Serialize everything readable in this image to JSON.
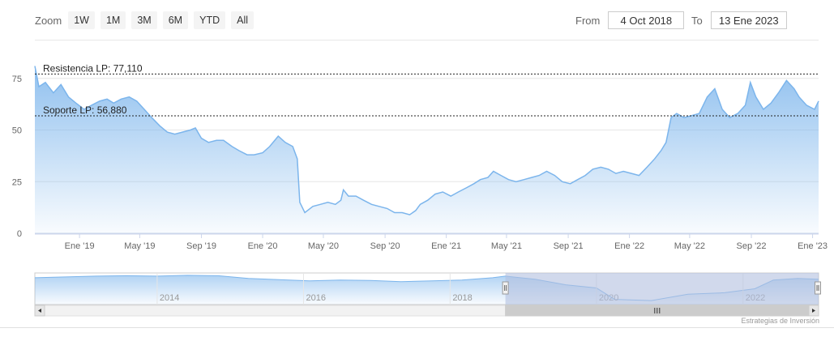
{
  "range_selector": {
    "zoom_label": "Zoom",
    "buttons": [
      "1W",
      "1M",
      "3M",
      "6M",
      "YTD",
      "All"
    ],
    "from_label": "From",
    "from_value": "4 Oct 2018",
    "to_label": "To",
    "to_value": "13 Ene 2023"
  },
  "credit": "Estrategias de Inversión",
  "colors": {
    "line": "#7cb5ec",
    "fill_top": "#7cb5ec",
    "reference_line": "#222222",
    "navigator_mask": "#b3bfe0"
  },
  "chart_data": {
    "type": "area",
    "title": "",
    "xlabel": "",
    "ylabel": "",
    "ylim": [
      0,
      80
    ],
    "yticks": [
      0,
      25,
      50,
      75
    ],
    "x_range": [
      "2018-10-04",
      "2023-01-13"
    ],
    "x_tick_labels": [
      {
        "date": "2019-01-01",
        "label": "Ene '19"
      },
      {
        "date": "2019-05-01",
        "label": "May '19"
      },
      {
        "date": "2019-09-01",
        "label": "Sep '19"
      },
      {
        "date": "2020-01-01",
        "label": "Ene '20"
      },
      {
        "date": "2020-05-01",
        "label": "May '20"
      },
      {
        "date": "2020-09-01",
        "label": "Sep '20"
      },
      {
        "date": "2021-01-01",
        "label": "Ene '21"
      },
      {
        "date": "2021-05-01",
        "label": "May '21"
      },
      {
        "date": "2021-09-01",
        "label": "Sep '21"
      },
      {
        "date": "2022-01-01",
        "label": "Ene '22"
      },
      {
        "date": "2022-05-01",
        "label": "May '22"
      },
      {
        "date": "2022-09-01",
        "label": "Sep '22"
      },
      {
        "date": "2023-01-01",
        "label": "Ene '23"
      }
    ],
    "series": [
      {
        "points": [
          [
            "2018-10-04",
            81
          ],
          [
            "2018-10-12",
            71
          ],
          [
            "2018-10-25",
            73
          ],
          [
            "2018-11-10",
            68
          ],
          [
            "2018-11-25",
            72
          ],
          [
            "2018-12-10",
            66
          ],
          [
            "2018-12-25",
            63
          ],
          [
            "2019-01-10",
            60
          ],
          [
            "2019-01-25",
            62
          ],
          [
            "2019-02-10",
            64
          ],
          [
            "2019-02-25",
            65
          ],
          [
            "2019-03-10",
            63
          ],
          [
            "2019-03-25",
            65
          ],
          [
            "2019-04-10",
            66
          ],
          [
            "2019-04-25",
            64
          ],
          [
            "2019-05-10",
            60
          ],
          [
            "2019-05-25",
            56
          ],
          [
            "2019-06-10",
            52
          ],
          [
            "2019-06-25",
            49
          ],
          [
            "2019-07-10",
            48
          ],
          [
            "2019-07-25",
            49
          ],
          [
            "2019-08-10",
            50
          ],
          [
            "2019-08-20",
            51
          ],
          [
            "2019-09-01",
            46
          ],
          [
            "2019-09-15",
            44
          ],
          [
            "2019-10-01",
            45
          ],
          [
            "2019-10-15",
            45
          ],
          [
            "2019-11-01",
            42
          ],
          [
            "2019-11-15",
            40
          ],
          [
            "2019-12-01",
            38
          ],
          [
            "2019-12-15",
            38
          ],
          [
            "2020-01-01",
            39
          ],
          [
            "2020-01-15",
            42
          ],
          [
            "2020-02-01",
            47
          ],
          [
            "2020-02-15",
            44
          ],
          [
            "2020-03-01",
            42
          ],
          [
            "2020-03-10",
            36
          ],
          [
            "2020-03-15",
            15
          ],
          [
            "2020-03-25",
            10
          ],
          [
            "2020-04-10",
            13
          ],
          [
            "2020-04-25",
            14
          ],
          [
            "2020-05-10",
            15
          ],
          [
            "2020-05-25",
            14
          ],
          [
            "2020-06-05",
            16
          ],
          [
            "2020-06-10",
            21
          ],
          [
            "2020-06-20",
            18
          ],
          [
            "2020-07-05",
            18
          ],
          [
            "2020-07-20",
            16
          ],
          [
            "2020-08-05",
            14
          ],
          [
            "2020-08-20",
            13
          ],
          [
            "2020-09-05",
            12
          ],
          [
            "2020-09-20",
            10
          ],
          [
            "2020-10-05",
            10
          ],
          [
            "2020-10-20",
            9
          ],
          [
            "2020-11-01",
            11
          ],
          [
            "2020-11-10",
            14
          ],
          [
            "2020-11-25",
            16
          ],
          [
            "2020-12-10",
            19
          ],
          [
            "2020-12-25",
            20
          ],
          [
            "2021-01-10",
            18
          ],
          [
            "2021-01-25",
            20
          ],
          [
            "2021-02-10",
            22
          ],
          [
            "2021-02-25",
            24
          ],
          [
            "2021-03-10",
            26
          ],
          [
            "2021-03-25",
            27
          ],
          [
            "2021-04-05",
            30
          ],
          [
            "2021-04-20",
            28
          ],
          [
            "2021-05-05",
            26
          ],
          [
            "2021-05-20",
            25
          ],
          [
            "2021-06-05",
            26
          ],
          [
            "2021-06-20",
            27
          ],
          [
            "2021-07-05",
            28
          ],
          [
            "2021-07-20",
            30
          ],
          [
            "2021-08-05",
            28
          ],
          [
            "2021-08-20",
            25
          ],
          [
            "2021-09-05",
            24
          ],
          [
            "2021-09-20",
            26
          ],
          [
            "2021-10-05",
            28
          ],
          [
            "2021-10-20",
            31
          ],
          [
            "2021-11-05",
            32
          ],
          [
            "2021-11-20",
            31
          ],
          [
            "2021-12-05",
            29
          ],
          [
            "2021-12-20",
            30
          ],
          [
            "2022-01-05",
            29
          ],
          [
            "2022-01-20",
            28
          ],
          [
            "2022-02-05",
            32
          ],
          [
            "2022-02-20",
            36
          ],
          [
            "2022-03-05",
            40
          ],
          [
            "2022-03-15",
            44
          ],
          [
            "2022-03-25",
            56
          ],
          [
            "2022-04-05",
            58
          ],
          [
            "2022-04-20",
            56
          ],
          [
            "2022-05-05",
            57
          ],
          [
            "2022-05-20",
            58
          ],
          [
            "2022-06-05",
            66
          ],
          [
            "2022-06-20",
            70
          ],
          [
            "2022-07-05",
            60
          ],
          [
            "2022-07-20",
            56
          ],
          [
            "2022-08-05",
            58
          ],
          [
            "2022-08-20",
            62
          ],
          [
            "2022-08-30",
            73
          ],
          [
            "2022-09-10",
            66
          ],
          [
            "2022-09-25",
            60
          ],
          [
            "2022-10-10",
            63
          ],
          [
            "2022-10-25",
            68
          ],
          [
            "2022-11-10",
            74
          ],
          [
            "2022-11-25",
            70
          ],
          [
            "2022-12-05",
            66
          ],
          [
            "2022-12-20",
            62
          ],
          [
            "2023-01-05",
            60
          ],
          [
            "2023-01-13",
            64
          ]
        ]
      }
    ],
    "reference_lines": [
      {
        "label": "Resistencia LP: 77,110",
        "value": 77.11
      },
      {
        "label": "Soporte LP: 56,880",
        "value": 56.88
      }
    ],
    "navigator": {
      "x_range": [
        "2012-05-01",
        "2023-01-13"
      ],
      "year_labels": [
        "2014",
        "2016",
        "2018",
        "2020",
        "2022"
      ],
      "selected_range": [
        "2018-10-04",
        "2023-01-13"
      ],
      "points": [
        [
          "2012-05-01",
          68
        ],
        [
          "2012-10-01",
          70
        ],
        [
          "2013-03-01",
          72
        ],
        [
          "2013-08-01",
          73
        ],
        [
          "2014-01-01",
          72
        ],
        [
          "2014-06-01",
          74
        ],
        [
          "2014-11-01",
          73
        ],
        [
          "2015-04-01",
          66
        ],
        [
          "2015-09-01",
          63
        ],
        [
          "2016-02-01",
          60
        ],
        [
          "2016-07-01",
          62
        ],
        [
          "2016-12-01",
          61
        ],
        [
          "2017-05-01",
          58
        ],
        [
          "2017-10-01",
          60
        ],
        [
          "2018-03-01",
          62
        ],
        [
          "2018-08-01",
          68
        ],
        [
          "2018-10-04",
          72
        ],
        [
          "2019-03-01",
          64
        ],
        [
          "2019-08-01",
          50
        ],
        [
          "2020-01-01",
          42
        ],
        [
          "2020-04-01",
          13
        ],
        [
          "2020-10-01",
          10
        ],
        [
          "2021-04-01",
          26
        ],
        [
          "2021-10-01",
          30
        ],
        [
          "2022-03-01",
          40
        ],
        [
          "2022-06-01",
          62
        ],
        [
          "2022-10-01",
          66
        ],
        [
          "2023-01-13",
          64
        ]
      ]
    }
  }
}
